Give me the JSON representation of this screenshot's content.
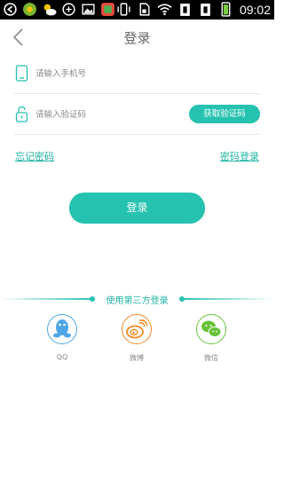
{
  "status_bar": {
    "time": "09:02"
  },
  "header": {
    "title": "登录"
  },
  "phone": {
    "placeholder": "请输入手机号"
  },
  "code": {
    "placeholder": "请输入验证码",
    "button_label": "获取验证码"
  },
  "links": {
    "forgot_password": "忘记密码",
    "password_login": "密码登录"
  },
  "login_button": "登录",
  "third_party": {
    "title": "使用第三方登录",
    "options": [
      {
        "label": "QQ",
        "icon": "qq-icon",
        "color": "#4da6e8"
      },
      {
        "label": "微博",
        "icon": "weibo-icon",
        "color": "#f08a24"
      },
      {
        "label": "微信",
        "icon": "wechat-icon",
        "color": "#67c23a"
      }
    ]
  },
  "colors": {
    "accent": "#26c2b0",
    "link": "#1eb4a3"
  }
}
